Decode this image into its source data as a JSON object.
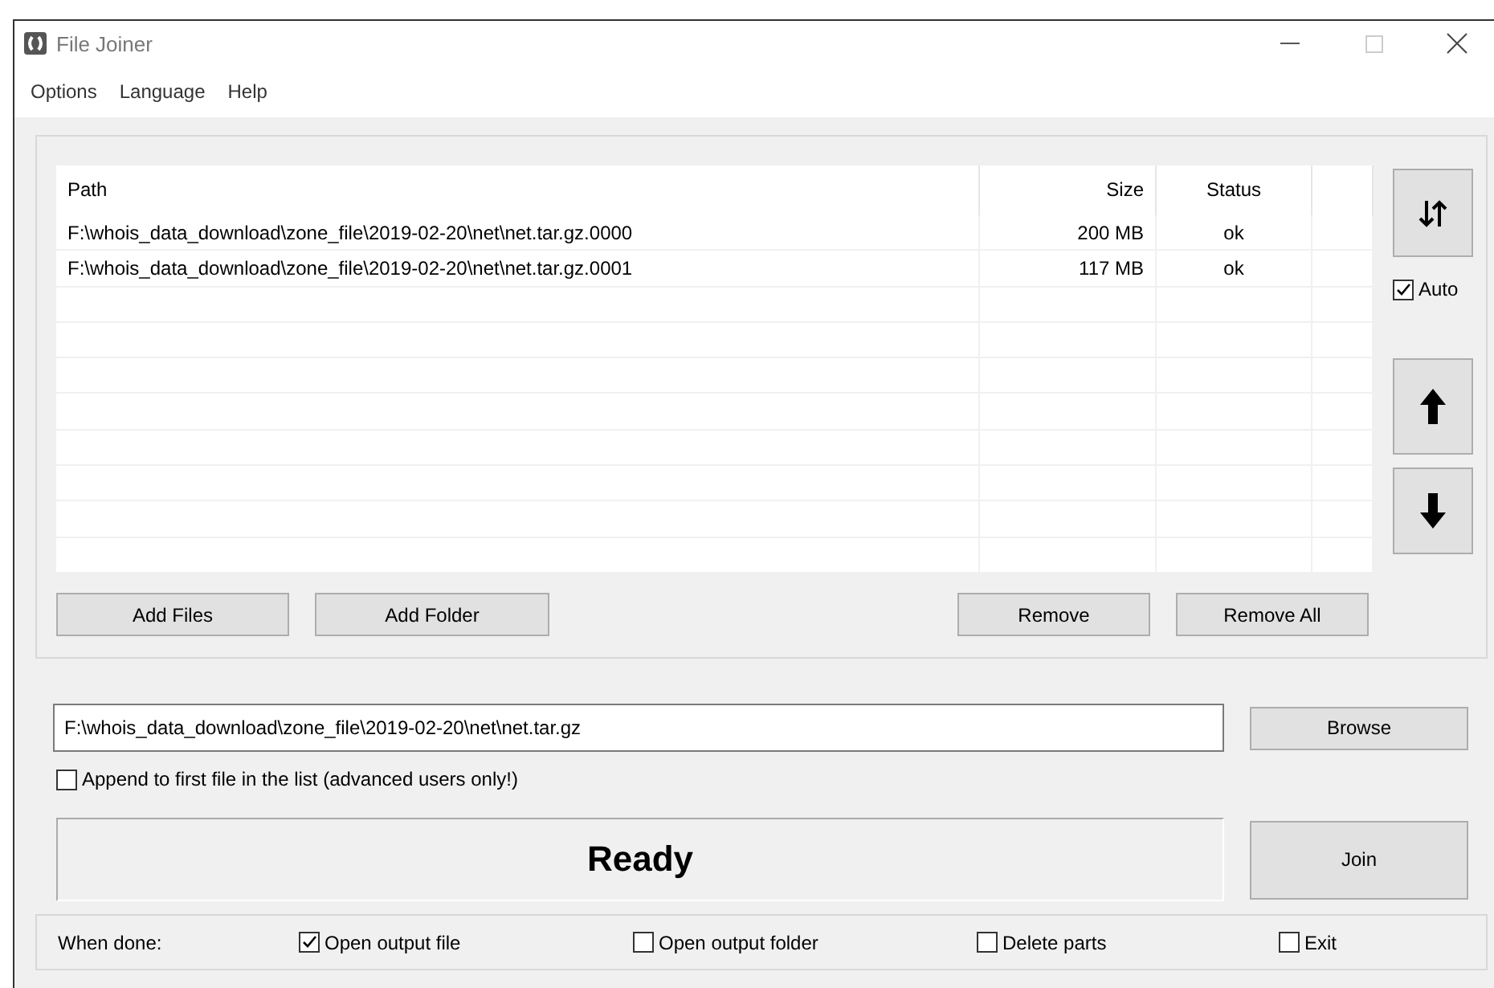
{
  "window": {
    "title": "File Joiner"
  },
  "menu": [
    "Options",
    "Language",
    "Help"
  ],
  "table": {
    "columns": [
      "Path",
      "Size",
      "Status"
    ],
    "rows": [
      {
        "path": "F:\\whois_data_download\\zone_file\\2019-02-20\\net\\net.tar.gz.0000",
        "size": "200 MB",
        "status": "ok"
      },
      {
        "path": "F:\\whois_data_download\\zone_file\\2019-02-20\\net\\net.tar.gz.0001",
        "size": "117 MB",
        "status": "ok"
      }
    ]
  },
  "auto": {
    "label": "Auto",
    "checked": true
  },
  "list_buttons": [
    "Add Files",
    "Add Folder",
    "Remove",
    "Remove All"
  ],
  "output": {
    "value": "F:\\whois_data_download\\zone_file\\2019-02-20\\net\\net.tar.gz",
    "browse": "Browse"
  },
  "append": {
    "label": "Append to first file in the list (advanced users only!)",
    "checked": false
  },
  "status": "Ready",
  "join": "Join",
  "when_done": {
    "label": "When done:",
    "options": [
      {
        "label": "Open output file",
        "checked": true
      },
      {
        "label": "Open output folder",
        "checked": false
      },
      {
        "label": "Delete parts",
        "checked": false
      },
      {
        "label": "Exit",
        "checked": false
      }
    ]
  }
}
